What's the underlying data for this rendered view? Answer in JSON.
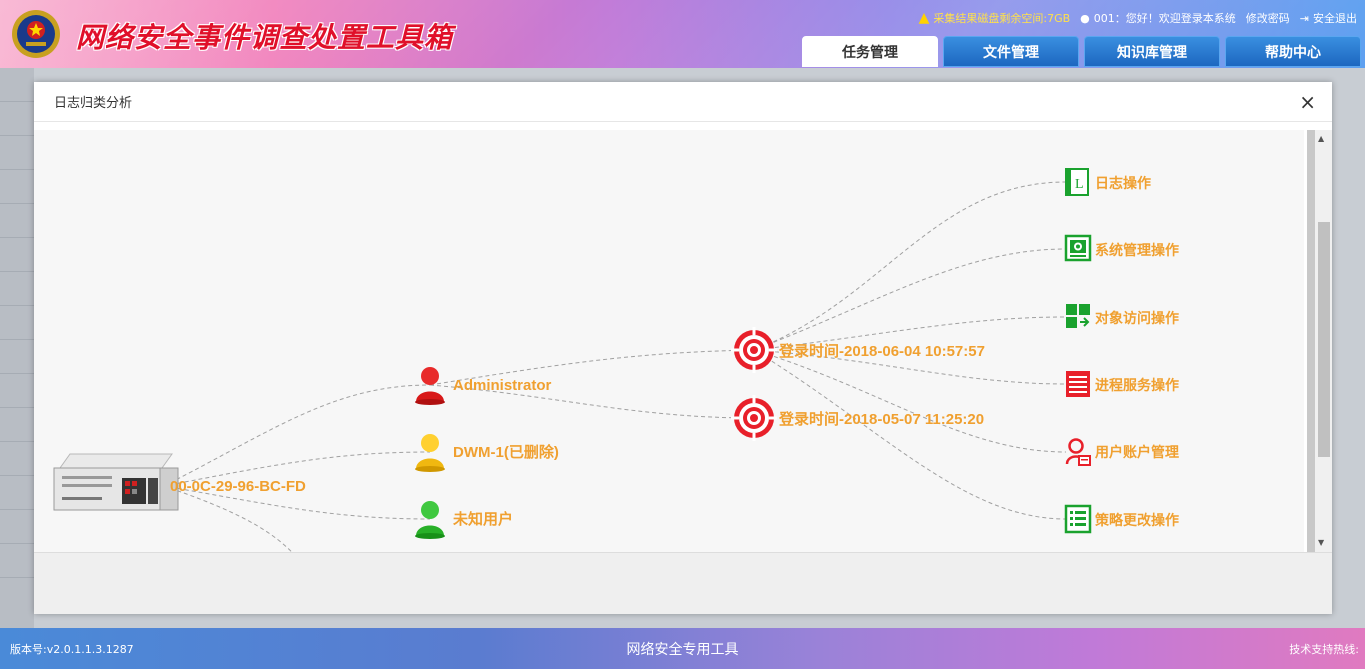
{
  "header": {
    "title": "网络安全事件调查处置工具箱",
    "disk_warning": "采集结果磁盘剩余空间:7GB",
    "greeting": "001：您好！欢迎登录本系统",
    "change_password": "修改密码",
    "logout": "安全退出"
  },
  "nav_tabs": [
    {
      "label": "任务管理",
      "active": true
    },
    {
      "label": "文件管理",
      "active": false
    },
    {
      "label": "知识库管理",
      "active": false
    },
    {
      "label": "帮助中心",
      "active": false
    }
  ],
  "modal": {
    "title": "日志归类分析",
    "close": "×"
  },
  "graph": {
    "root": "00-0C-29-96-BC-FD",
    "users": [
      {
        "label": "Administrator",
        "color": "red"
      },
      {
        "label": "DWM-1(已删除)",
        "color": "yellow"
      },
      {
        "label": "未知用户",
        "color": "green"
      }
    ],
    "sessions": [
      {
        "label": "登录时间-2018-06-04 10:57:57"
      },
      {
        "label": "登录时间-2018-05-07 11:25:20"
      }
    ],
    "categories": [
      {
        "label": "日志操作",
        "icon": "log-book-icon"
      },
      {
        "label": "系统管理操作",
        "icon": "system-settings-icon"
      },
      {
        "label": "对象访问操作",
        "icon": "object-access-icon"
      },
      {
        "label": "进程服务操作",
        "icon": "process-list-icon"
      },
      {
        "label": "用户账户管理",
        "icon": "user-account-icon"
      },
      {
        "label": "策略更改操作",
        "icon": "policy-list-icon"
      }
    ],
    "colors": {
      "label": "#f0a030",
      "category_icon": "#1aa22e",
      "target": "#e8202a"
    }
  },
  "footer": {
    "version": "版本号:v2.0.1.1.3.1287",
    "center": "网络安全专用工具",
    "support": "技术支持热线:"
  }
}
